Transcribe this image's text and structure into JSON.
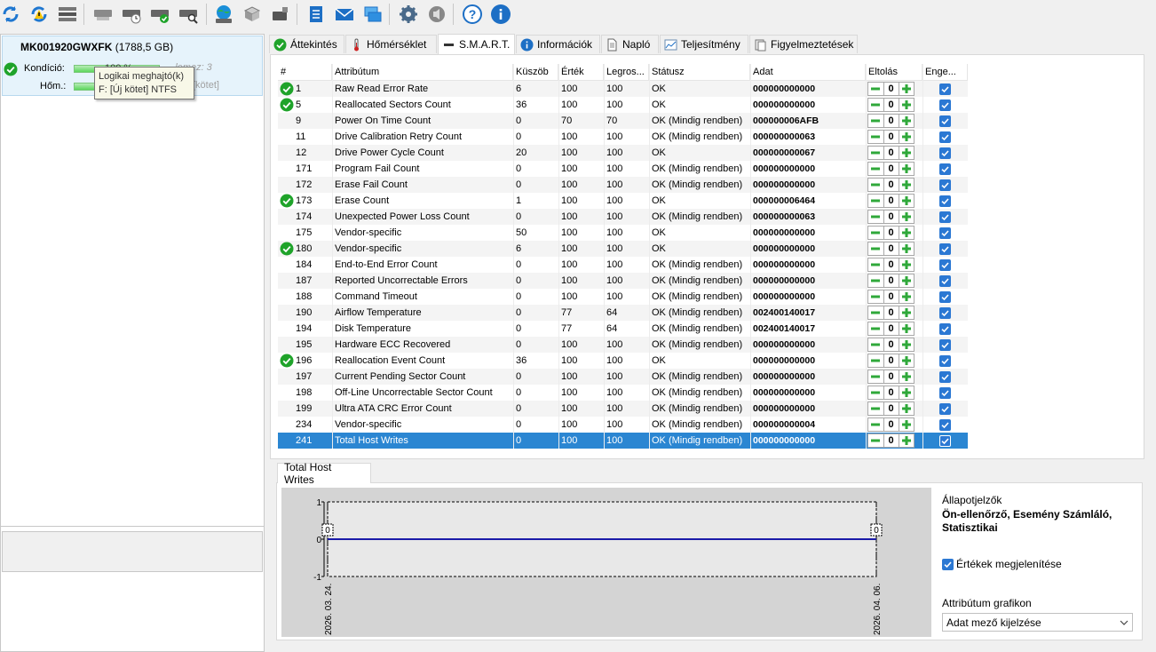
{
  "toolbar": {
    "buttons": [
      "refresh-icon",
      "refresh-all-icon",
      "hdd-list-icon",
      "drive-gray-icon",
      "drive-clock-icon",
      "drive-check-icon",
      "drive-search-icon",
      "network-globe-icon",
      "drives-icon",
      "usb-drive-icon",
      "notes-icon",
      "mail-icon",
      "network-computer-icon",
      "settings-gear-icon",
      "sound-icon",
      "help-icon",
      "info-icon"
    ]
  },
  "drive": {
    "name": "MK001920GWXFK",
    "size": "(1788,5 GB)",
    "health_label": "Kondíció:",
    "health_value": "100 %",
    "health_level": 1.0,
    "temp_label": "Hőm.:",
    "faded_right_1": "... lemez: 3",
    "faded_right_2": "[kötet]",
    "tooltip_line1": "Logikai meghajtó(k)",
    "tooltip_line2": "F: [Új kötet] NTFS"
  },
  "tabs": [
    {
      "label": "Áttekintés",
      "icon": "check-circle-icon"
    },
    {
      "label": "Hőmérséklet",
      "icon": "thermometer-icon"
    },
    {
      "label": "S.M.A.R.T.",
      "icon": "drive-dash-icon",
      "active": true
    },
    {
      "label": "Információk",
      "icon": "info-icon"
    },
    {
      "label": "Napló",
      "icon": "document-icon"
    },
    {
      "label": "Teljesítmény",
      "icon": "chart-icon"
    },
    {
      "label": "Figyelmeztetések",
      "icon": "alerts-icon"
    }
  ],
  "grid": {
    "headers": [
      "#",
      "Attribútum",
      "Küszöb",
      "Érték",
      "Legros...",
      "Státusz",
      "Adat",
      "Eltolás",
      "Enge..."
    ],
    "rows": [
      {
        "ok": true,
        "id": "1",
        "name": "Raw Read Error Rate",
        "thr": "6",
        "val": "100",
        "worst": "100",
        "status": "OK",
        "data": "000000000000",
        "offset": "0"
      },
      {
        "ok": true,
        "id": "5",
        "name": "Reallocated Sectors Count",
        "thr": "36",
        "val": "100",
        "worst": "100",
        "status": "OK",
        "data": "000000000000",
        "offset": "0"
      },
      {
        "ok": false,
        "id": "9",
        "name": "Power On Time Count",
        "thr": "0",
        "val": "70",
        "worst": "70",
        "status": "OK (Mindig rendben)",
        "data": "000000006AFB",
        "offset": "0"
      },
      {
        "ok": false,
        "id": "11",
        "name": "Drive Calibration Retry Count",
        "thr": "0",
        "val": "100",
        "worst": "100",
        "status": "OK (Mindig rendben)",
        "data": "000000000063",
        "offset": "0"
      },
      {
        "ok": false,
        "id": "12",
        "name": "Drive Power Cycle Count",
        "thr": "20",
        "val": "100",
        "worst": "100",
        "status": "OK",
        "data": "000000000067",
        "offset": "0"
      },
      {
        "ok": false,
        "id": "171",
        "name": "Program Fail Count",
        "thr": "0",
        "val": "100",
        "worst": "100",
        "status": "OK (Mindig rendben)",
        "data": "000000000000",
        "offset": "0"
      },
      {
        "ok": false,
        "id": "172",
        "name": "Erase Fail Count",
        "thr": "0",
        "val": "100",
        "worst": "100",
        "status": "OK (Mindig rendben)",
        "data": "000000000000",
        "offset": "0"
      },
      {
        "ok": true,
        "id": "173",
        "name": "Erase Count",
        "thr": "1",
        "val": "100",
        "worst": "100",
        "status": "OK",
        "data": "000000006464",
        "offset": "0"
      },
      {
        "ok": false,
        "id": "174",
        "name": "Unexpected Power Loss Count",
        "thr": "0",
        "val": "100",
        "worst": "100",
        "status": "OK (Mindig rendben)",
        "data": "000000000063",
        "offset": "0"
      },
      {
        "ok": false,
        "id": "175",
        "name": "Vendor-specific",
        "thr": "50",
        "val": "100",
        "worst": "100",
        "status": "OK",
        "data": "000000000000",
        "offset": "0"
      },
      {
        "ok": true,
        "id": "180",
        "name": "Vendor-specific",
        "thr": "6",
        "val": "100",
        "worst": "100",
        "status": "OK",
        "data": "000000000000",
        "offset": "0"
      },
      {
        "ok": false,
        "id": "184",
        "name": "End-to-End Error Count",
        "thr": "0",
        "val": "100",
        "worst": "100",
        "status": "OK (Mindig rendben)",
        "data": "000000000000",
        "offset": "0"
      },
      {
        "ok": false,
        "id": "187",
        "name": "Reported Uncorrectable Errors",
        "thr": "0",
        "val": "100",
        "worst": "100",
        "status": "OK (Mindig rendben)",
        "data": "000000000000",
        "offset": "0"
      },
      {
        "ok": false,
        "id": "188",
        "name": "Command Timeout",
        "thr": "0",
        "val": "100",
        "worst": "100",
        "status": "OK (Mindig rendben)",
        "data": "000000000000",
        "offset": "0"
      },
      {
        "ok": false,
        "id": "190",
        "name": "Airflow Temperature",
        "thr": "0",
        "val": "77",
        "worst": "64",
        "status": "OK (Mindig rendben)",
        "data": "002400140017",
        "offset": "0"
      },
      {
        "ok": false,
        "id": "194",
        "name": "Disk Temperature",
        "thr": "0",
        "val": "77",
        "worst": "64",
        "status": "OK (Mindig rendben)",
        "data": "002400140017",
        "offset": "0"
      },
      {
        "ok": false,
        "id": "195",
        "name": "Hardware ECC Recovered",
        "thr": "0",
        "val": "100",
        "worst": "100",
        "status": "OK (Mindig rendben)",
        "data": "000000000000",
        "offset": "0"
      },
      {
        "ok": true,
        "id": "196",
        "name": "Reallocation Event Count",
        "thr": "36",
        "val": "100",
        "worst": "100",
        "status": "OK",
        "data": "000000000000",
        "offset": "0"
      },
      {
        "ok": false,
        "id": "197",
        "name": "Current Pending Sector Count",
        "thr": "0",
        "val": "100",
        "worst": "100",
        "status": "OK (Mindig rendben)",
        "data": "000000000000",
        "offset": "0"
      },
      {
        "ok": false,
        "id": "198",
        "name": "Off-Line Uncorrectable Sector Count",
        "thr": "0",
        "val": "100",
        "worst": "100",
        "status": "OK (Mindig rendben)",
        "data": "000000000000",
        "offset": "0"
      },
      {
        "ok": false,
        "id": "199",
        "name": "Ultra ATA CRC Error Count",
        "thr": "0",
        "val": "100",
        "worst": "100",
        "status": "OK (Mindig rendben)",
        "data": "000000000000",
        "offset": "0"
      },
      {
        "ok": false,
        "id": "234",
        "name": "Vendor-specific",
        "thr": "0",
        "val": "100",
        "worst": "100",
        "status": "OK (Mindig rendben)",
        "data": "000000000004",
        "offset": "0"
      },
      {
        "ok": false,
        "id": "241",
        "name": "Total Host Writes",
        "thr": "0",
        "val": "100",
        "worst": "100",
        "status": "OK (Mindig rendben)",
        "data": "000000000000",
        "offset": "0",
        "selected": true
      }
    ]
  },
  "bottom": {
    "tab_label": "Total Host Writes",
    "status_title": "Állapotjelzők",
    "status_value": "Ön-ellenőrző, Esemény Számláló, Statisztikai",
    "show_values_label": "Értékek megjelenítése",
    "show_values_checked": true,
    "graph_label": "Attribútum grafikon",
    "graph_select_value": "Adat mező kijelzése"
  },
  "chart_data": {
    "type": "line",
    "x": [
      "2026. 03. 24.",
      "2026. 04. 06."
    ],
    "series": [
      {
        "values": [
          0,
          0
        ]
      }
    ],
    "point_labels": [
      "0",
      "0"
    ],
    "y_ticks": [
      "1",
      "0",
      "-1"
    ],
    "ylim": [
      -1,
      1
    ],
    "line_color": "#1a1aa8"
  }
}
